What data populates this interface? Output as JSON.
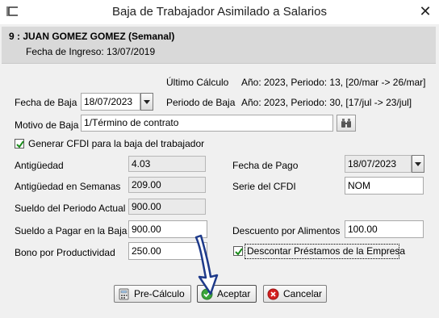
{
  "window": {
    "title": "Baja de Trabajador Asimilado a Salarios",
    "close_label": "✕"
  },
  "header": {
    "employee": "9 : JUAN GOMEZ GOMEZ (Semanal)",
    "hire_date": "Fecha de Ingreso: 13/07/2019"
  },
  "calc": {
    "ultimo_label": "Último Cálculo",
    "ultimo_value": "Año: 2023, Periodo: 13, [20/mar -> 26/mar]",
    "periodo_label": "Periodo de Baja",
    "periodo_value": "Año: 2023, Periodo: 30, [17/jul -> 23/jul]"
  },
  "form": {
    "fecha_baja_label": "Fecha de Baja",
    "fecha_baja_value": "18/07/2023",
    "motivo_label": "Motivo de Baja",
    "motivo_value": "1/Término de contrato",
    "cfdi_checkbox_label": "Generar CFDI para la baja del trabajador",
    "cfdi_checked": true,
    "antiguedad_label": "Antigüedad",
    "antiguedad_value": "4.03",
    "antig_semanas_label": "Antigüedad en Semanas",
    "antig_semanas_value": "209.00",
    "sueldo_periodo_label": "Sueldo del Periodo Actual",
    "sueldo_periodo_value": "900.00",
    "sueldo_baja_label": "Sueldo a Pagar en la Baja",
    "sueldo_baja_value": "900.00",
    "bono_label": "Bono por Productividad",
    "bono_value": "250.00",
    "fecha_pago_label": "Fecha de Pago",
    "fecha_pago_value": "18/07/2023",
    "serie_label": "Serie del CFDI",
    "serie_value": "NOM",
    "descuento_label": "Descuento por Alimentos",
    "descuento_value": "100.00",
    "descontar_label": "Descontar Préstamos de la Empresa",
    "descontar_checked": true
  },
  "buttons": {
    "precalculo": "Pre-Cálculo",
    "aceptar": "Aceptar",
    "cancelar": "Cancelar"
  },
  "colors": {
    "title_bg": "#ffffff",
    "header_bg": "#d9d9d9",
    "window_bg": "#f0f0f0",
    "check_green": "#1a8c1a",
    "cancel_red": "#d42020",
    "accept_green": "#3aa53a"
  }
}
